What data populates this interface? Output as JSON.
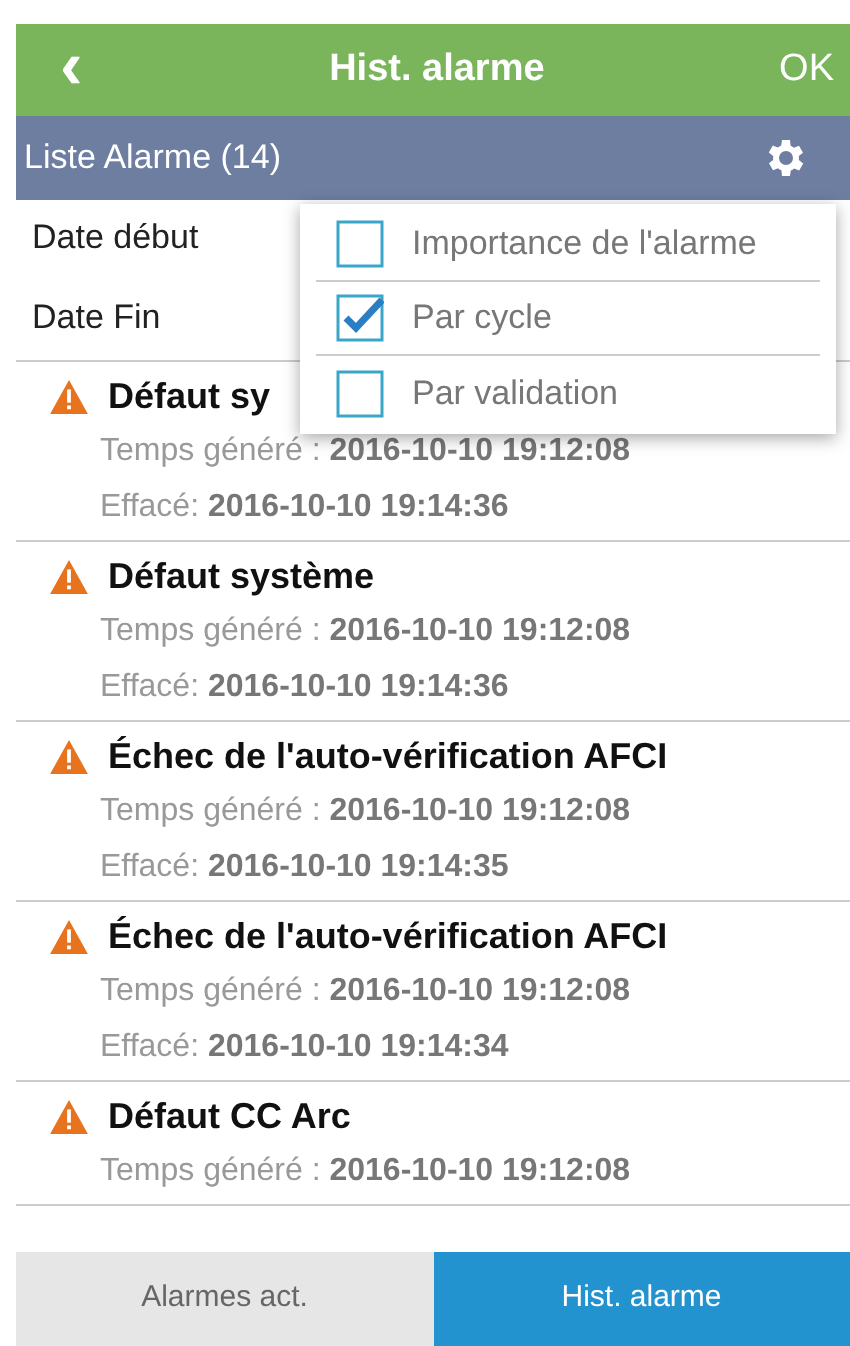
{
  "header": {
    "back": "‹",
    "title": "Hist. alarme",
    "ok": "OK"
  },
  "subheader": {
    "title": "Liste Alarme (14)"
  },
  "filters": [
    {
      "label": "Date début"
    },
    {
      "label": "Date Fin"
    }
  ],
  "menu": [
    {
      "label": "Importance de l'alarme",
      "checked": false
    },
    {
      "label": "Par cycle",
      "checked": true
    },
    {
      "label": "Par validation",
      "checked": false
    }
  ],
  "alarms": [
    {
      "title": "Défaut sy",
      "lines": [
        "Temps généré : **2016-10-10 19:12:08**",
        "Effacé: **2016-10-10 19:14:36**"
      ]
    },
    {
      "title": "Défaut système",
      "lines": [
        "Temps généré : **2016-10-10 19:12:08**",
        "Effacé: **2016-10-10 19:14:36**"
      ]
    },
    {
      "title": "Échec de l'auto-vérification AFCI",
      "lines": [
        "Temps généré : **2016-10-10 19:12:08**",
        "Effacé: **2016-10-10 19:14:35**"
      ]
    },
    {
      "title": "Échec de l'auto-vérification AFCI",
      "lines": [
        "Temps généré : **2016-10-10 19:12:08**",
        "Effacé: **2016-10-10 19:14:34**"
      ]
    },
    {
      "title": "Défaut CC Arc",
      "lines": [
        "Temps généré : **2016-10-10 19:12:08**"
      ]
    }
  ],
  "tabs": [
    {
      "label": "Alarmes act.",
      "selected": false
    },
    {
      "label": "Hist. alarme",
      "selected": true
    }
  ]
}
